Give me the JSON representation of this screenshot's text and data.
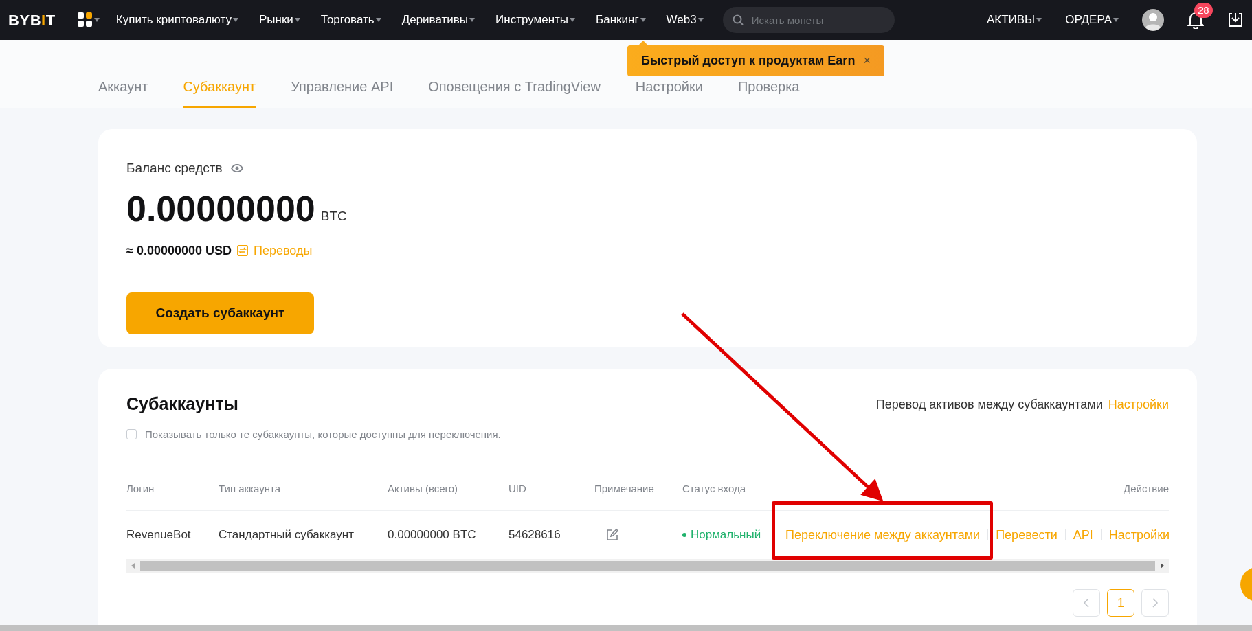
{
  "nav": {
    "logo": [
      {
        "text": "BYB",
        "color": "#ffffff"
      },
      {
        "text": "I",
        "color": "#f7a600"
      },
      {
        "text": "T",
        "color": "#ffffff"
      }
    ],
    "menu": [
      {
        "label": "Купить криптовалюту"
      },
      {
        "label": "Рынки"
      },
      {
        "label": "Торговать"
      },
      {
        "label": "Деривативы"
      },
      {
        "label": "Инструменты"
      },
      {
        "label": "Банкинг"
      },
      {
        "label": "Web3"
      }
    ],
    "search": {
      "placeholder": "Искать монеты"
    },
    "right_menu": [
      {
        "label": "АКТИВЫ"
      },
      {
        "label": "ОРДЕРА"
      }
    ],
    "notifications_badge": "28"
  },
  "tooltip": {
    "text": "Быстрый доступ к продуктам Earn",
    "close": "×"
  },
  "tabs": [
    {
      "label": "Аккаунт",
      "selected": false
    },
    {
      "label": "Субаккаунт",
      "selected": true
    },
    {
      "label": "Управление API",
      "selected": false
    },
    {
      "label": "Оповещения с TradingView",
      "selected": false
    },
    {
      "label": "Настройки",
      "selected": false
    },
    {
      "label": "Проверка",
      "selected": false
    }
  ],
  "balance": {
    "label": "Баланс средств",
    "amount": "0.00000000",
    "unit": "BTC",
    "usd": "≈ 0.00000000 USD",
    "transfers_link": "Переводы",
    "create_button": "Создать субаккаунт"
  },
  "subaccounts": {
    "title": "Субаккаунты",
    "filter": {
      "label": "Показывать только те субаккаунты, которые доступны для переключения.",
      "checked": false
    },
    "transfer_text": "Перевод активов между субаккаунтами",
    "transfer_link": "Настройки",
    "columns": [
      "Логин",
      "Тип аккаунта",
      "Активы (всего)",
      "UID",
      "Примечание",
      "Статус входа",
      "Действие"
    ],
    "rows": [
      {
        "login": "RevenueBot",
        "type": "Стандартный субаккаунт",
        "assets": "0.00000000 BTC",
        "uid": "54628616",
        "status": {
          "label": "Нормальный",
          "color": "#20b26c"
        },
        "actions": [
          "Переключение между аккаунтами",
          "Перевести",
          "API",
          "Настройки"
        ]
      }
    ],
    "pagination": {
      "pages": [
        {
          "label": "1",
          "selected": true
        }
      ]
    }
  },
  "annotation": {
    "color": "#e00000"
  }
}
